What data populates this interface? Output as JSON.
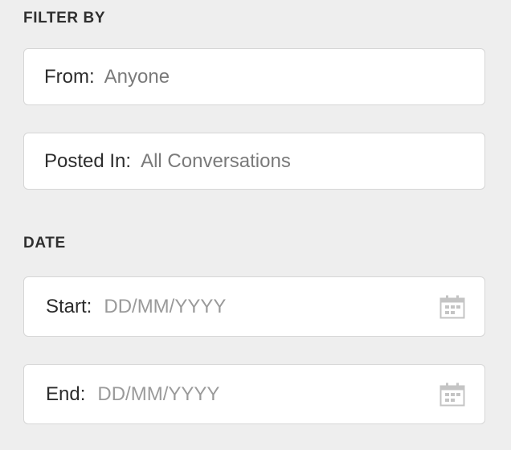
{
  "filter": {
    "heading": "FILTER BY",
    "from": {
      "label": "From:",
      "value": "Anyone"
    },
    "posted_in": {
      "label": "Posted In:",
      "value": "All Conversations"
    }
  },
  "date": {
    "heading": "DATE",
    "start": {
      "label": "Start:",
      "placeholder": "DD/MM/YYYY"
    },
    "end": {
      "label": "End:",
      "placeholder": "DD/MM/YYYY"
    }
  },
  "icons": {
    "calendar": "calendar-icon"
  },
  "colors": {
    "background": "#eeeeee",
    "field_background": "#ffffff",
    "field_border": "#d6d6d6",
    "label_text": "#2c2c2c",
    "value_text": "#7a7a7a",
    "icon": "#c4c4c4"
  }
}
